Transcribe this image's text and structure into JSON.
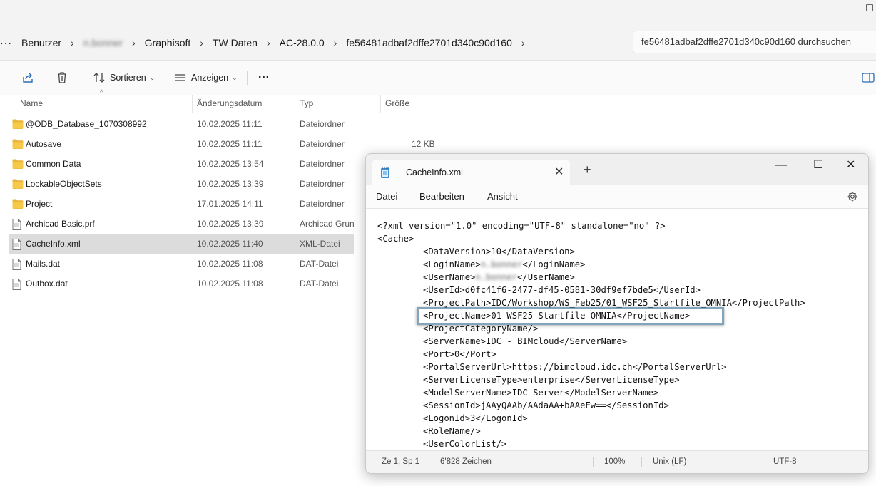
{
  "explorer": {
    "breadcrumb": [
      "Benutzer",
      "n.bonner",
      "Graphisoft",
      "TW Daten",
      "AC-28.0.0",
      "fe56481adbaf2dffe2701d340c90d160"
    ],
    "search_placeholder": "fe56481adbaf2dffe2701d340c90d160 durchsuchen",
    "toolbar": {
      "sort_label": "Sortieren",
      "view_label": "Anzeigen",
      "more_label": "···"
    },
    "columns": {
      "name": "Name",
      "date": "Änderungsdatum",
      "type": "Typ",
      "size": "Größe"
    },
    "files": [
      {
        "name": "@ODB_Database_1070308992",
        "date": "10.02.2025 11:11",
        "type": "Dateiordner",
        "kind": "folder"
      },
      {
        "name": "Autosave",
        "date": "10.02.2025 11:11",
        "type": "Dateiordner",
        "kind": "folder"
      },
      {
        "name": "Common Data",
        "date": "10.02.2025 13:54",
        "type": "Dateiordner",
        "kind": "folder"
      },
      {
        "name": "LockableObjectSets",
        "date": "10.02.2025 13:39",
        "type": "Dateiordner",
        "kind": "folder"
      },
      {
        "name": "Project",
        "date": "17.01.2025 14:11",
        "type": "Dateiordner",
        "kind": "folder"
      },
      {
        "name": "Archicad Basic.prf",
        "date": "10.02.2025 13:39",
        "type": "Archicad Grun",
        "kind": "file"
      },
      {
        "name": "CacheInfo.xml",
        "date": "10.02.2025 11:40",
        "type": "XML-Datei",
        "kind": "file",
        "selected": true
      },
      {
        "name": "Mails.dat",
        "date": "10.02.2025 11:08",
        "type": "DAT-Datei",
        "kind": "file"
      },
      {
        "name": "Outbox.dat",
        "date": "10.02.2025 11:08",
        "type": "DAT-Datei",
        "kind": "file"
      }
    ],
    "size_value": "12 KB"
  },
  "notepad": {
    "tab_title": "CacheInfo.xml",
    "menu": [
      "Datei",
      "Bearbeiten",
      "Ansicht"
    ],
    "lines": [
      {
        "text": "<?xml version=\"1.0\" encoding=\"UTF-8\" standalone=\"no\" ?>",
        "indent": 0
      },
      {
        "text": "<Cache>",
        "indent": 0
      },
      {
        "text": "<DataVersion>10</DataVersion>",
        "indent": 1
      },
      {
        "pre": "<LoginName>",
        "blur": "n.bonner",
        "post": "</LoginName>",
        "indent": 1
      },
      {
        "pre": "<UserName>",
        "blur": "n.bonner",
        "post": "</UserName>",
        "indent": 1
      },
      {
        "text": "<UserId>d0fc41f6-2477-df45-0581-30df9ef7bde5</UserId>",
        "indent": 1
      },
      {
        "text": "<ProjectPath>IDC/Workshop/WS_Feb25/01_WSF25_Startfile_OMNIA</ProjectPath>",
        "indent": 1
      },
      {
        "text": "<ProjectName>01 WSF25 Startfile OMNIA</ProjectName>",
        "indent": 1,
        "highlight": true
      },
      {
        "text": "<ProjectCategoryName/>",
        "indent": 1
      },
      {
        "text": "<ServerName>IDC - BIMcloud</ServerName>",
        "indent": 1
      },
      {
        "text": "<Port>0</Port>",
        "indent": 1
      },
      {
        "text": "<PortalServerUrl>https://bimcloud.idc.ch</PortalServerUrl>",
        "indent": 1
      },
      {
        "text": "<ServerLicenseType>enterprise</ServerLicenseType>",
        "indent": 1
      },
      {
        "text": "<ModelServerName>IDC Server</ModelServerName>",
        "indent": 1
      },
      {
        "text": "<SessionId>jAAyQAAb/AAdaAA+bAAeEw==</SessionId>",
        "indent": 1
      },
      {
        "text": "<LogonId>3</LogonId>",
        "indent": 1
      },
      {
        "text": "<RoleName/>",
        "indent": 1
      },
      {
        "text": "<UserColorList/>",
        "indent": 1
      }
    ],
    "status": {
      "position": "Ze 1, Sp 1",
      "chars": "6'828 Zeichen",
      "zoom": "100%",
      "eol": "Unix (LF)",
      "encoding": "UTF-8"
    }
  }
}
